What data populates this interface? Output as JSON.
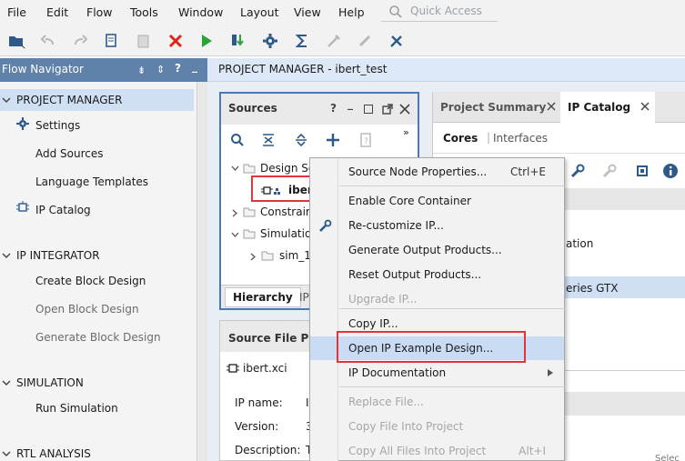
{
  "menubar": {
    "items": [
      "File",
      "Edit",
      "Flow",
      "Tools",
      "Window",
      "Layout",
      "View",
      "Help"
    ],
    "quick_access_placeholder": "Quick Access"
  },
  "flow_navigator": {
    "title": "Flow Navigator",
    "sections": [
      {
        "label": "PROJECT MANAGER",
        "items": [
          "Settings",
          "Add Sources",
          "Language Templates",
          "IP Catalog"
        ]
      },
      {
        "label": "IP INTEGRATOR",
        "items": [
          "Create Block Design",
          "Open Block Design",
          "Generate Block Design"
        ]
      },
      {
        "label": "SIMULATION",
        "items": [
          "Run Simulation"
        ]
      },
      {
        "label": "RTL ANALYSIS",
        "items": []
      }
    ]
  },
  "project_manager": {
    "title": "PROJECT MANAGER - ibert_test"
  },
  "sources": {
    "title": "Sources",
    "tree": [
      "Design So",
      "iber",
      "Constrain",
      "Simulation",
      "sim_1"
    ],
    "tabs": [
      "Hierarchy",
      "IP"
    ]
  },
  "source_file_props": {
    "title": "Source File P",
    "file": "ibert.xci",
    "labels": [
      "IP name:",
      "Version:",
      "Description:"
    ],
    "values": [
      "I",
      "3",
      "T"
    ]
  },
  "right_panel": {
    "tabs": [
      "Project Summary",
      "IP Catalog"
    ],
    "subtabs": [
      "Cores",
      "Interfaces"
    ],
    "rows": [
      "ation",
      "eries GTX"
    ],
    "footer": "Selec"
  },
  "context_menu": {
    "items": [
      {
        "label": "Source Node Properties...",
        "shortcut": "Ctrl+E",
        "disabled": false
      },
      {
        "label": "Enable Core Container",
        "shortcut": "",
        "disabled": false
      },
      {
        "label": "Re-customize IP...",
        "shortcut": "",
        "disabled": false
      },
      {
        "label": "Generate Output Products...",
        "shortcut": "",
        "disabled": false
      },
      {
        "label": "Reset Output Products...",
        "shortcut": "",
        "disabled": false
      },
      {
        "label": "Upgrade IP...",
        "shortcut": "",
        "disabled": true
      },
      {
        "label": "Copy IP...",
        "shortcut": "",
        "disabled": false
      },
      {
        "label": "Open IP Example Design...",
        "shortcut": "",
        "disabled": false
      },
      {
        "label": "IP Documentation",
        "shortcut": "",
        "disabled": false
      },
      {
        "label": "Replace File...",
        "shortcut": "",
        "disabled": true
      },
      {
        "label": "Copy File Into Project",
        "shortcut": "",
        "disabled": true
      },
      {
        "label": "Copy All Files Into Project",
        "shortcut": "Alt+I",
        "disabled": true
      }
    ]
  },
  "colors": {
    "accent": "#4a78c0",
    "highlight": "#c9dcf4",
    "annotation": "#e0353a",
    "navigator_header": "#5f81aa"
  }
}
